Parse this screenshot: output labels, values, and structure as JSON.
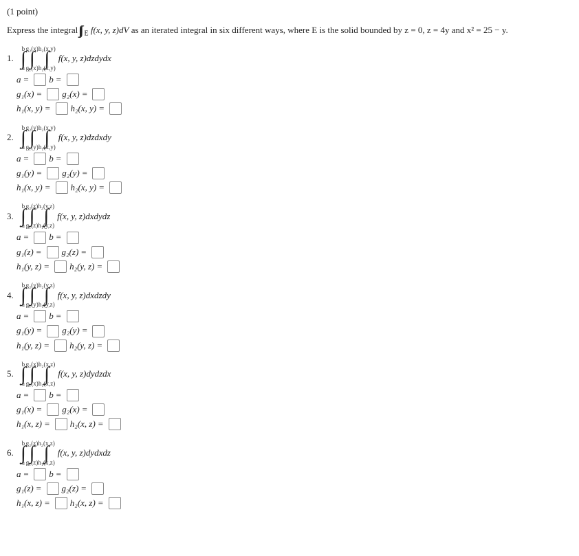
{
  "points": "(1 point)",
  "prompt_pre": "Express the integral",
  "prompt_int_sub": "E",
  "prompt_integrand": "f(x, y, z)dV",
  "prompt_post": "as an iterated integral in six different ways, where E is the solid bounded by z = 0, z = 4y and x² = 25 − y.",
  "problems": [
    {
      "num": "1.",
      "outer": {
        "low": "a",
        "high": "b"
      },
      "mid": {
        "low": "g₁(x)",
        "high": "g₂(x)"
      },
      "inner": {
        "low": "h₁(x,y)",
        "high": "h₂(x,y)"
      },
      "integrand": "f(x, y, z)dzdydx",
      "g_lhs1": "g₁(x)",
      "g_lhs2": "g₂(x)",
      "h_lhs1": "h₁(x, y)",
      "h_lhs2": "h₂(x, y)"
    },
    {
      "num": "2.",
      "outer": {
        "low": "a",
        "high": "b"
      },
      "mid": {
        "low": "g₁(y)",
        "high": "g₂(y)"
      },
      "inner": {
        "low": "h₁(x,y)",
        "high": "h₂(x,y)"
      },
      "integrand": "f(x, y, z)dzdxdy",
      "g_lhs1": "g₁(y)",
      "g_lhs2": "g₂(y)",
      "h_lhs1": "h₁(x, y)",
      "h_lhs2": "h₂(x, y)"
    },
    {
      "num": "3.",
      "outer": {
        "low": "a",
        "high": "b"
      },
      "mid": {
        "low": "g₁(z)",
        "high": "g₂(z)"
      },
      "inner": {
        "low": "h₁(y,z)",
        "high": "h₂(y,z)"
      },
      "integrand": "f(x, y, z)dxdydz",
      "g_lhs1": "g₁(z)",
      "g_lhs2": "g₂(z)",
      "h_lhs1": "h₁(y, z)",
      "h_lhs2": "h₂(y, z)"
    },
    {
      "num": "4.",
      "outer": {
        "low": "a",
        "high": "b"
      },
      "mid": {
        "low": "g₁(y)",
        "high": "g₂(y)"
      },
      "inner": {
        "low": "h₁(y,z)",
        "high": "h₂(y,z)"
      },
      "integrand": "f(x, y, z)dxdzdy",
      "g_lhs1": "g₁(y)",
      "g_lhs2": "g₂(y)",
      "h_lhs1": "h₁(y, z)",
      "h_lhs2": "h₂(y, z)"
    },
    {
      "num": "5.",
      "outer": {
        "low": "a",
        "high": "b"
      },
      "mid": {
        "low": "g₁(x)",
        "high": "g₂(x)"
      },
      "inner": {
        "low": "h₁(x,z)",
        "high": "h₂(x,z)"
      },
      "integrand": "f(x, y, z)dydzdx",
      "g_lhs1": "g₁(x)",
      "g_lhs2": "g₂(x)",
      "h_lhs1": "h₁(x, z)",
      "h_lhs2": "h₂(x, z)"
    },
    {
      "num": "6.",
      "outer": {
        "low": "a",
        "high": "b"
      },
      "mid": {
        "low": "g₁(z)",
        "high": "g₂(z)"
      },
      "inner": {
        "low": "h₁(x,z)",
        "high": "h₂(x,z)"
      },
      "integrand": "f(x, y, z)dydxdz",
      "g_lhs1": "g₁(z)",
      "g_lhs2": "g₂(z)",
      "h_lhs1": "h₁(x, z)",
      "h_lhs2": "h₂(x, z)"
    }
  ],
  "labels": {
    "a": "a",
    "b": "b",
    "eq": "="
  }
}
